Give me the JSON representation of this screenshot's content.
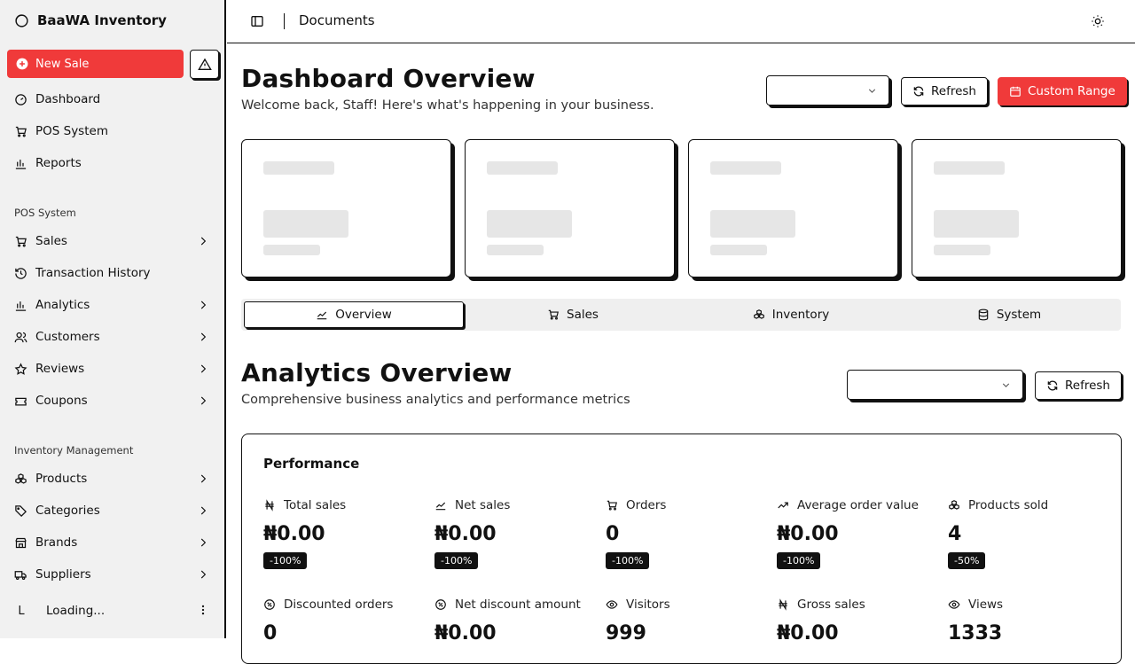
{
  "app": {
    "title": "BaaWA Inventory"
  },
  "sidebar": {
    "new_sale": "New Sale",
    "top_items": [
      {
        "label": "Dashboard",
        "icon": "gauge-icon"
      },
      {
        "label": "POS System",
        "icon": "cart-icon"
      },
      {
        "label": "Reports",
        "icon": "bar-chart-icon"
      }
    ],
    "group1_label": "POS System",
    "group1_items": [
      {
        "label": "Sales",
        "icon": "cart-icon",
        "chevron": true
      },
      {
        "label": "Transaction History",
        "icon": "history-icon",
        "chevron": false
      },
      {
        "label": "Analytics",
        "icon": "bar-chart-icon",
        "chevron": true
      },
      {
        "label": "Customers",
        "icon": "users-icon",
        "chevron": true
      },
      {
        "label": "Reviews",
        "icon": "star-icon",
        "chevron": true
      },
      {
        "label": "Coupons",
        "icon": "ticket-icon",
        "chevron": true
      }
    ],
    "group2_label": "Inventory Management",
    "group2_items": [
      {
        "label": "Products",
        "icon": "boxes-icon",
        "chevron": true
      },
      {
        "label": "Categories",
        "icon": "tag-icon",
        "chevron": true
      },
      {
        "label": "Brands",
        "icon": "store-icon",
        "chevron": true
      },
      {
        "label": "Suppliers",
        "icon": "truck-icon",
        "chevron": true
      }
    ],
    "user": {
      "initial": "L",
      "name": "Loading..."
    }
  },
  "header": {
    "breadcrumb": "Documents"
  },
  "dashboard": {
    "title": "Dashboard Overview",
    "subtitle": "Welcome back, Staff! Here's what's happening in your business.",
    "refresh": "Refresh",
    "custom_range": "Custom Range"
  },
  "tabs": [
    {
      "label": "Overview",
      "icon": "trend-icon",
      "active": true
    },
    {
      "label": "Sales",
      "icon": "cart-icon",
      "active": false
    },
    {
      "label": "Inventory",
      "icon": "boxes-icon",
      "active": false
    },
    {
      "label": "System",
      "icon": "database-icon",
      "active": false
    }
  ],
  "analytics": {
    "title": "Analytics Overview",
    "subtitle": "Comprehensive business analytics and performance metrics",
    "refresh": "Refresh"
  },
  "performance": {
    "title": "Performance",
    "metrics": [
      {
        "label": "Total sales",
        "icon": "naira-icon",
        "value": "₦0.00",
        "badge": "-100%"
      },
      {
        "label": "Net sales",
        "icon": "trend-icon",
        "value": "₦0.00",
        "badge": "-100%"
      },
      {
        "label": "Orders",
        "icon": "cart-icon",
        "value": "0",
        "badge": "-100%"
      },
      {
        "label": "Average order value",
        "icon": "trending-up-icon",
        "value": "₦0.00",
        "badge": "-100%"
      },
      {
        "label": "Products sold",
        "icon": "boxes-icon",
        "value": "4",
        "badge": "-50%"
      },
      {
        "label": "Discounted orders",
        "icon": "percent-icon",
        "value": "0",
        "badge": ""
      },
      {
        "label": "Net discount amount",
        "icon": "percent-icon",
        "value": "₦0.00",
        "badge": ""
      },
      {
        "label": "Visitors",
        "icon": "eye-icon",
        "value": "999",
        "badge": ""
      },
      {
        "label": "Gross sales",
        "icon": "naira-icon",
        "value": "₦0.00",
        "badge": ""
      },
      {
        "label": "Views",
        "icon": "eye-icon",
        "value": "1333",
        "badge": ""
      }
    ]
  }
}
